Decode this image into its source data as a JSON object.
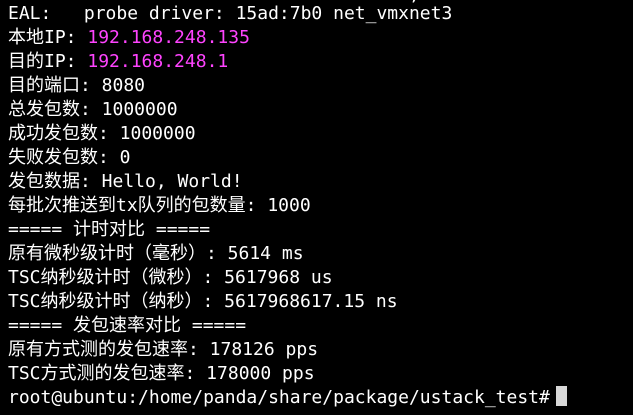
{
  "colors": {
    "background": "#000000",
    "text": "#ffffff",
    "ip_highlight": "#ff44ff",
    "cursor": "#d8d8d8"
  },
  "terminal": {
    "partial_top_line": "                                     ,",
    "lines": {
      "eal": "EAL:   probe driver: 15ad:7b0 net_vmxnet3",
      "local_ip_label": "本地IP: ",
      "local_ip_value": "192.168.248.135",
      "dest_ip_label": "目的IP: ",
      "dest_ip_value": "192.168.248.1",
      "dest_port": "目的端口: 8080",
      "total_sent": "总发包数: 1000000",
      "success_sent": "成功发包数: 1000000",
      "failed_sent": "失败发包数: 0",
      "payload": "发包数据: Hello, World!",
      "batch_size": "每批次推送到tx队列的包数量: 1000",
      "timing_header": "===== 计时对比 =====",
      "orig_ms": "原有微秒级计时（毫秒）: 5614 ms",
      "tsc_us": "TSC纳秒级计时（微秒）: 5617968 us",
      "tsc_ns": "TSC纳秒级计时（纳秒）: 5617968617.15 ns",
      "rate_header": "===== 发包速率对比 =====",
      "orig_rate": "原有方式测的发包速率: 178126 pps",
      "tsc_rate": "TSC方式测的发包速率: 178000 pps",
      "prompt": "root@ubuntu:/home/panda/share/package/ustack_test#"
    }
  }
}
